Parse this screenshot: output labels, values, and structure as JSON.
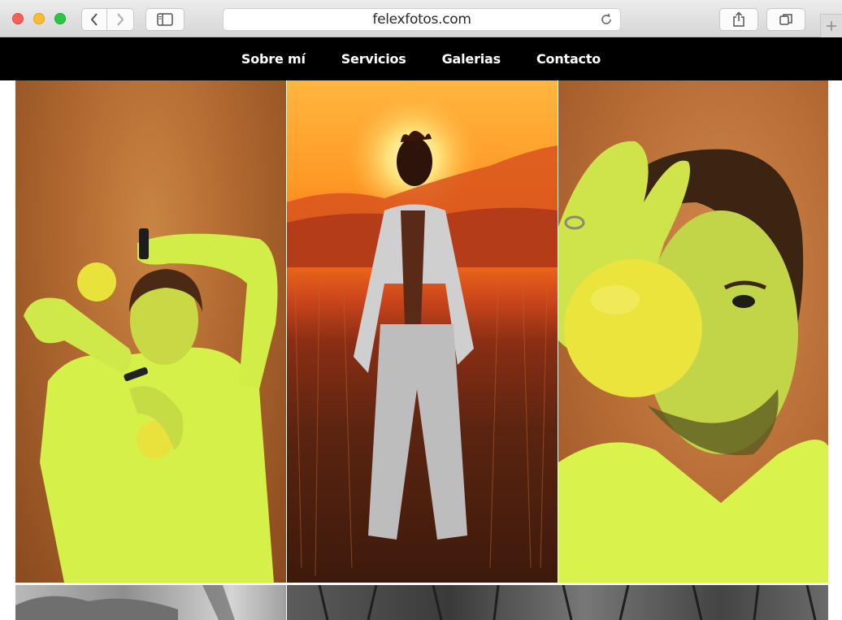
{
  "browser": {
    "url": "felexfotos.com",
    "icons": {
      "back": "chevron-left-icon",
      "forward": "chevron-right-icon",
      "sidebar": "sidebar-icon",
      "reload": "reload-icon",
      "share": "share-icon",
      "tabs": "tabs-icon",
      "new_tab": "plus-icon"
    }
  },
  "nav": {
    "items": [
      {
        "label": "Sobre mí"
      },
      {
        "label": "Servicios"
      },
      {
        "label": "Galerias"
      },
      {
        "label": "Contacto"
      }
    ]
  },
  "gallery": {
    "photos": [
      {
        "subject": "man-with-yellow-balls-photo"
      },
      {
        "subject": "man-in-field-at-sunset-photo"
      },
      {
        "subject": "man-holding-yellow-ball-to-eye-photo"
      },
      {
        "subject": "bw-landscape-photo"
      },
      {
        "subject": "bw-bare-trees-photo"
      }
    ]
  },
  "colors": {
    "nav_bg": "#000000",
    "nav_text": "#ffffff",
    "accent_yellow": "#e6e83a"
  }
}
